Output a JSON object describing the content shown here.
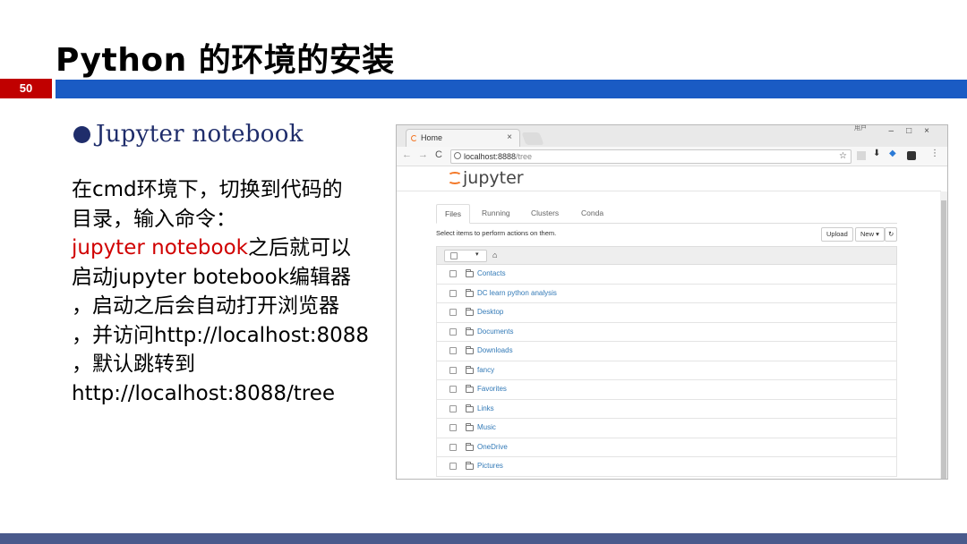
{
  "slide": {
    "title": "Python 的环境的安装",
    "page_number": "50",
    "bullet": "Jupyter notebook",
    "body_lines": [
      {
        "text": "在cmd环境下，切换到代码的"
      },
      {
        "text": "目录，输入命令："
      },
      {
        "red": "jupyter notebook",
        "text": "之后就可以"
      },
      {
        "text": "启动jupyter botebook编辑器"
      },
      {
        "text": "，启动之后会自动打开浏览器"
      },
      {
        "text": "，并访问http://localhost:8088"
      },
      {
        "text": "，默认跳转到"
      },
      {
        "text": "http://localhost:8088/tree"
      }
    ],
    "accent_color": "#1a5bc4",
    "highlight_color": "#d00000"
  },
  "browser": {
    "tab_title": "Home",
    "tab_close": "×",
    "window_label": "用户",
    "window_controls": "–□×",
    "nav_back": "←",
    "nav_forward": "→",
    "nav_reload": "C",
    "url_host": "localhost:8888",
    "url_path": "/tree",
    "bookmark_icon": "star-icon"
  },
  "jupyter": {
    "logo_text": "jupyter",
    "tabs": [
      "Files",
      "Running",
      "Clusters",
      "Conda"
    ],
    "active_tab": "Files",
    "select_info": "Select items to perform actions on them.",
    "upload_label": "Upload",
    "new_label": "New ▾",
    "refresh_label": "↻",
    "dropdown_caret": "▾",
    "home_glyph": "⌂",
    "files": [
      "Contacts",
      "DC learn python analysis",
      "Desktop",
      "Documents",
      "Downloads",
      "fancy",
      "Favorites",
      "Links",
      "Music",
      "OneDrive",
      "Pictures"
    ]
  }
}
